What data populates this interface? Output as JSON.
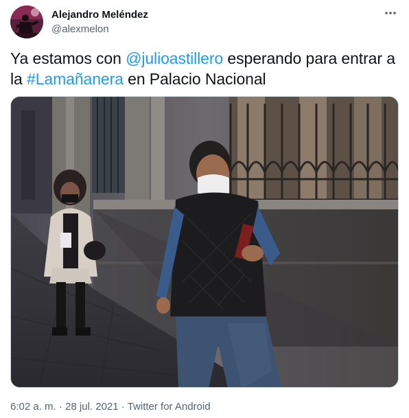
{
  "author": {
    "display_name": "Alejandro Meléndez",
    "handle": "@alexmelon",
    "avatar_icon": "profile-photo"
  },
  "more_icon": "more-dots-icon",
  "tweet": {
    "text_before_mention": "Ya estamos con ",
    "mention": "@julioastillero",
    "text_middle": " esperando para entrar a la ",
    "hashtag": "#Lamañanera",
    "text_after": " en Palacio Nacional"
  },
  "meta": {
    "time": "6:02 a. m.",
    "separator_1": " · ",
    "date": "28 jul. 2021",
    "separator_2": " · ",
    "source": "Twitter for Android"
  },
  "colors": {
    "link": "#1d9bf0",
    "text": "#0f1419",
    "secondary": "#536471",
    "border": "#cfd9de"
  }
}
